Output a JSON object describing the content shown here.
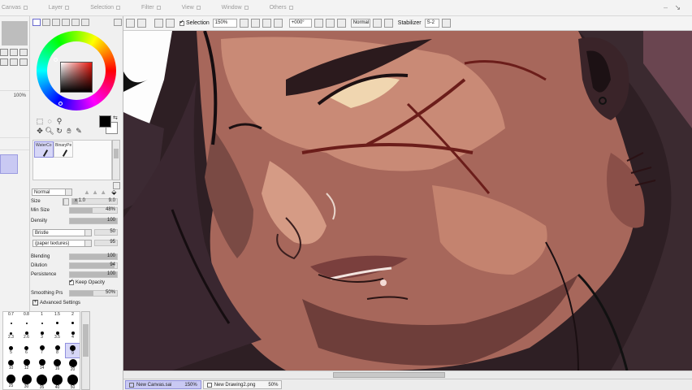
{
  "menu": [
    {
      "label": "Canvas"
    },
    {
      "label": "Layer"
    },
    {
      "label": "Selection"
    },
    {
      "label": "Filter"
    },
    {
      "label": "View"
    },
    {
      "label": "Window"
    },
    {
      "label": "Others"
    }
  ],
  "left_strip": {
    "zoom_pct": "100%"
  },
  "brush_panel": {
    "brushes": [
      {
        "label": "WaterCo"
      },
      {
        "label": "BinaryPe"
      }
    ],
    "blend_mode": "Normal",
    "size_multiplier": "x 1.0",
    "size_value": "9.0",
    "min_size_label": "Min Size",
    "min_size_value": "48%",
    "min_size_fraction": 0.48,
    "density_label": "Density",
    "density_value": "100",
    "texture": "Bristle",
    "texture_value": "50",
    "paper_texture": "(paper textures)",
    "paper_value": "95",
    "blending_label": "Blending",
    "blending_value": "100",
    "dilution_label": "Dilution",
    "dilution_value": "94",
    "persistence_label": "Persistence",
    "persistence_value": "100",
    "keep_opacity_label": "Keep Opacity",
    "keep_opacity": true,
    "smoothing_label": "Smoothing Prs",
    "smoothing_value": "50%",
    "advanced_label": "Advanced Settings",
    "size_label": "Size"
  },
  "brush_sizes": [
    "0.7",
    "0.8",
    "1",
    "1.5",
    "2",
    "2.3",
    "2.6",
    "3",
    "3.5",
    "4",
    "5",
    "6",
    "7",
    "8",
    "9",
    "10",
    "12",
    "14",
    "16",
    "20",
    "25",
    "30",
    "35",
    "40",
    "50"
  ],
  "toolbar": {
    "selection_label": "Selection",
    "zoom": "150%",
    "rotation": "+000°",
    "blend": "Normal",
    "stabilizer_label": "Stabilizer",
    "stabilizer_value": "S-2"
  },
  "tabs": [
    {
      "name": "New Canvas.sai",
      "zoom": "150%",
      "active": true
    },
    {
      "name": "New Drawing2.png",
      "zoom": "50%",
      "active": false
    }
  ],
  "colors": {
    "foreground": "#000000",
    "background": "#ffffff",
    "accent": "#c9c9f3",
    "hue": "#e8160d"
  }
}
